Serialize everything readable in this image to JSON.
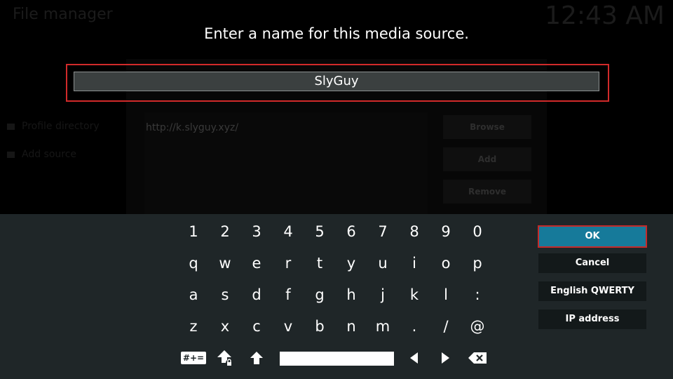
{
  "background": {
    "title": "File manager",
    "clock": "12:43 AM",
    "side_items": [
      "Profile directory",
      "Add source"
    ],
    "source_url": "http://k.slyguy.xyz/",
    "buttons": [
      "Browse",
      "Add",
      "Remove"
    ]
  },
  "dialog": {
    "prompt": "Enter a name for this media source.",
    "input_value": "SlyGuy"
  },
  "keyboard": {
    "rows": [
      [
        "1",
        "2",
        "3",
        "4",
        "5",
        "6",
        "7",
        "8",
        "9",
        "0"
      ],
      [
        "q",
        "w",
        "e",
        "r",
        "t",
        "y",
        "u",
        "i",
        "o",
        "p"
      ],
      [
        "a",
        "s",
        "d",
        "f",
        "g",
        "h",
        "j",
        "k",
        "l",
        ":"
      ],
      [
        "z",
        "x",
        "c",
        "v",
        "b",
        "n",
        "m",
        ".",
        "/",
        "@"
      ]
    ],
    "symbols_label": "#+=",
    "bottom_icons": [
      "symbols-toggle-icon",
      "caps-lock-icon",
      "shift-icon",
      "space-bar",
      "left-arrow-icon",
      "right-arrow-icon",
      "backspace-icon"
    ]
  },
  "actions": {
    "ok": "OK",
    "cancel": "Cancel",
    "layout": "English QWERTY",
    "ip": "IP address"
  },
  "colors": {
    "accent": "#167a9a",
    "focus_border": "#d12a2a",
    "panel": "#1f2628"
  }
}
